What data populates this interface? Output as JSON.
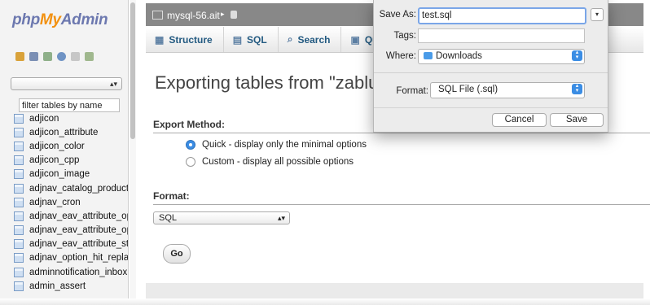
{
  "sidebar": {
    "logo": {
      "part1": "php",
      "part2": "My",
      "part3": "Admin"
    },
    "quick_icons": [
      "home-icon",
      "sql-icon",
      "exit-icon",
      "help-icon",
      "docs-icon",
      "settings-icon"
    ],
    "database_select": {
      "value": ""
    },
    "filter": {
      "value": "filter tables by name"
    },
    "tables": [
      "adjicon",
      "adjicon_attribute",
      "adjicon_color",
      "adjicon_cpp",
      "adjicon_image",
      "adjnav_catalog_product_",
      "adjnav_cron",
      "adjnav_eav_attribute_opt",
      "adjnav_eav_attribute_opt",
      "adjnav_eav_attribute_sta",
      "adjnav_option_hit_replac",
      "adminnotification_inbox",
      "admin_assert"
    ]
  },
  "breadcrumb": {
    "server": "mysql-56.ait",
    "separator": "▸"
  },
  "tabs": [
    {
      "label": "Structure",
      "icon": "structure-icon"
    },
    {
      "label": "SQL",
      "icon": "sql-icon"
    },
    {
      "label": "Search",
      "icon": "search-icon"
    },
    {
      "label": "Quer",
      "icon": "query-icon"
    }
  ],
  "main": {
    "title": "Exporting tables from \"zablu",
    "export_method": {
      "heading": "Export Method:",
      "options": [
        {
          "label": "Quick - display only the minimal options",
          "checked": true
        },
        {
          "label": "Custom - display all possible options",
          "checked": false
        }
      ]
    },
    "format": {
      "heading": "Format:",
      "value": "SQL"
    },
    "go_label": "Go"
  },
  "save_dialog": {
    "save_as_label": "Save As:",
    "save_as_value": "test.sql",
    "tags_label": "Tags:",
    "tags_value": "",
    "where_label": "Where:",
    "where_value": "Downloads",
    "format_label": "Format:",
    "format_value": "SQL File (.sql)",
    "cancel_label": "Cancel",
    "save_label": "Save"
  },
  "colors": {
    "accent": "#3b8de4",
    "logo_blue": "#6c78af",
    "logo_orange": "#f29111",
    "breadcrumb_bg": "#888888"
  }
}
